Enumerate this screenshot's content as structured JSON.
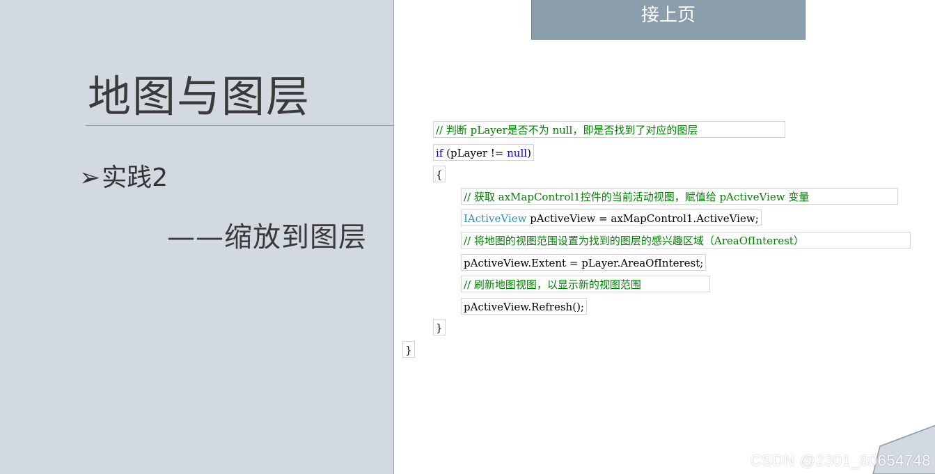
{
  "slide": {
    "title": "地图与图层",
    "bullet_symbol": "➢",
    "bullet": "实践2",
    "subtitle": "——缩放到图层"
  },
  "banner": "接上页",
  "code": {
    "line1_comment": "// 判断 pLayer是否不为 null，即是否找到了对应的图层",
    "line2_kw1": "if",
    "line2_mid": " (pLayer != ",
    "line2_kw2": "null",
    "line2_end": ")",
    "line3": "{",
    "line4_comment": "// 获取 axMapControl1控件的当前活动视图，赋值给 pActiveView 变量",
    "line5_type": "IActiveView",
    "line5_rest": " pActiveView = axMapControl1.ActiveView;",
    "line6_comment": "// 将地图的视图范围设置为找到的图层的感兴趣区域（AreaOfInterest）",
    "line7": "pActiveView.Extent = pLayer.AreaOfInterest;",
    "line8_comment": "// 刷新地图视图，以显示新的视图范围",
    "line9": "pActiveView.Refresh();",
    "line10": "}",
    "line11": "}"
  },
  "watermark": "CSDN @2301_80654748",
  "colors": {
    "left_background": "#d3d9e0",
    "banner": "#8a9daa",
    "comment": "#008000",
    "keyword": "#0000cc",
    "type": "#2b91af"
  }
}
